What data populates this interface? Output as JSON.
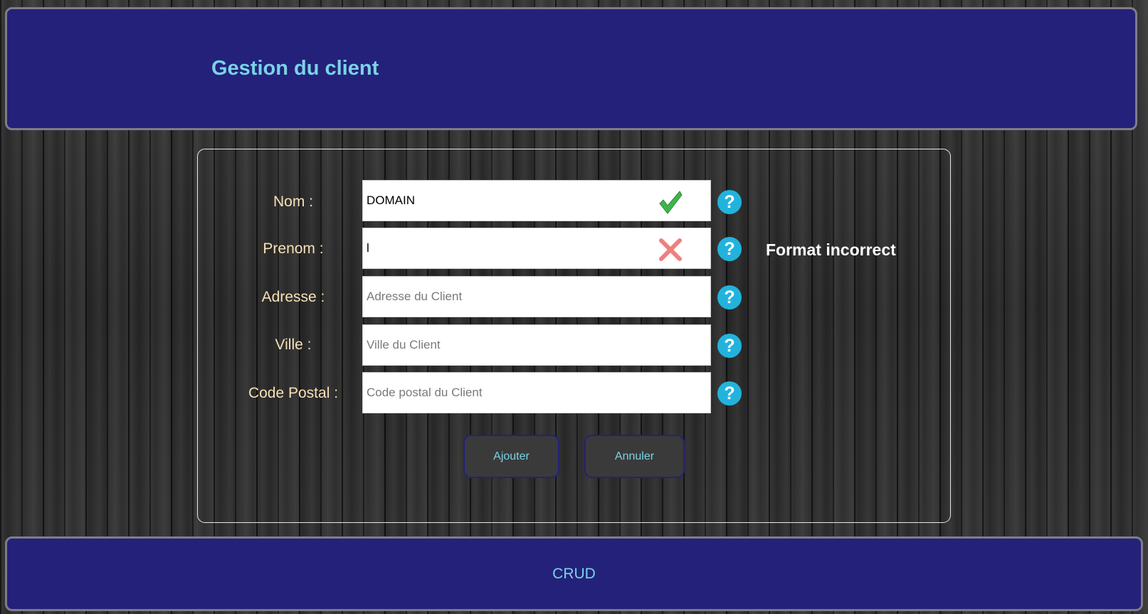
{
  "header": {
    "title": "Gestion du client"
  },
  "form": {
    "fields": [
      {
        "label": "Nom :",
        "value": "DOMAIN",
        "placeholder": "",
        "status": "valid",
        "status_icon": "checkmark-icon"
      },
      {
        "label": "Prenom :",
        "value": "l",
        "placeholder": "",
        "status": "invalid",
        "status_icon": "cross-icon"
      },
      {
        "label": "Adresse :",
        "value": "",
        "placeholder": "Adresse du Client"
      },
      {
        "label": "Ville :",
        "value": "",
        "placeholder": "Ville du Client"
      },
      {
        "label": "Code Postal :",
        "value": "",
        "placeholder": "Code postal du Client"
      }
    ],
    "help_icon": "question-mark-icon",
    "help_glyph": "?",
    "error_message": "Format incorrect",
    "buttons": {
      "add_label": "Ajouter",
      "cancel_label": "Annuler"
    }
  },
  "footer": {
    "text": "CRUD"
  },
  "colors": {
    "header_bg": "#24217a",
    "title": "#79d3e6",
    "label": "#f6e0b6",
    "help_icon": "#22b3dc",
    "valid": "#3db54a",
    "invalid": "#ef7f7f"
  }
}
